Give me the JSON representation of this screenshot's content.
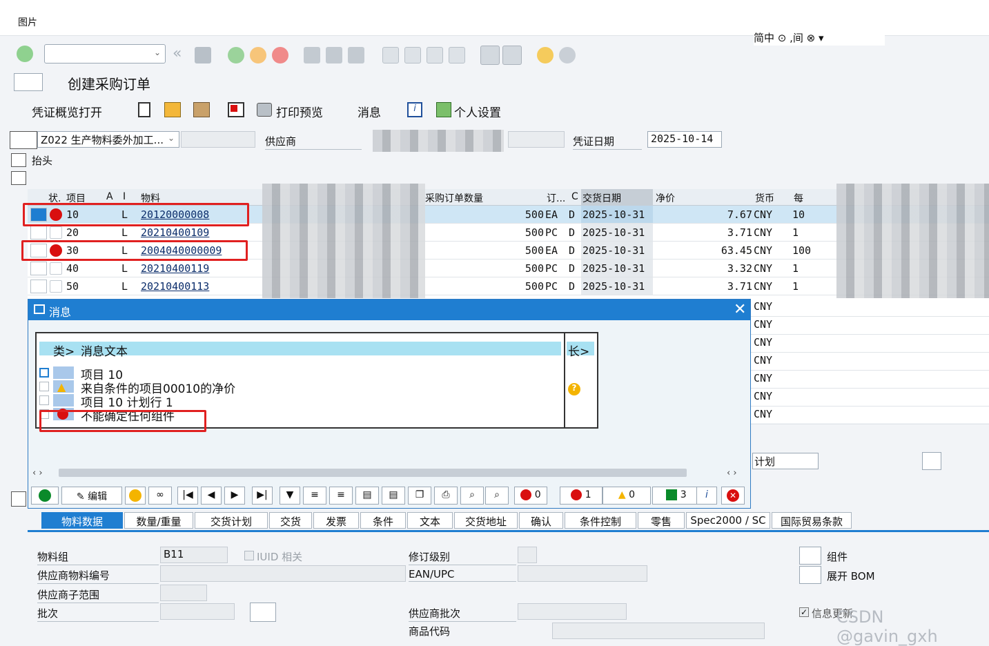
{
  "window": {
    "title": "图片"
  },
  "toolbar": {
    "command_field": "",
    "right_partial_text": "简中 ⊙ ,间 ⊗ ▾"
  },
  "screen": {
    "title": "创建采购订单"
  },
  "appbar": {
    "doc_overview": "凭证概览打开",
    "print_preview": "打印预览",
    "messages": "消息",
    "personal_settings": "个人设置"
  },
  "header": {
    "order_type": "Z022 生产物料委外加工...",
    "vendor_label": "供应商",
    "doc_date_label": "凭证日期",
    "doc_date": "2025-10-14",
    "header_label": "抬头"
  },
  "grid": {
    "headers": {
      "status": "状.",
      "item": "项目",
      "a": "A",
      "i": "I",
      "material": "物料",
      "po_qty": "采购订单数量",
      "order_unit": "订...",
      "c": "C",
      "delivery_date": "交货日期",
      "net_price": "净价",
      "currency": "货币",
      "per": "每"
    },
    "rows": [
      {
        "item": "10",
        "i": "L",
        "material": "20120000008",
        "qty": "500",
        "unit": "EA",
        "c": "D",
        "date": "2025-10-31",
        "price": "7.67",
        "currency": "CNY",
        "per": "10",
        "status": "error"
      },
      {
        "item": "20",
        "i": "L",
        "material": "20210400109",
        "qty": "500",
        "unit": "PC",
        "c": "D",
        "date": "2025-10-31",
        "price": "3.71",
        "currency": "CNY",
        "per": "1",
        "status": ""
      },
      {
        "item": "30",
        "i": "L",
        "material": "2004040000009",
        "qty": "500",
        "unit": "EA",
        "c": "D",
        "date": "2025-10-31",
        "price": "63.45",
        "currency": "CNY",
        "per": "100",
        "status": "error"
      },
      {
        "item": "40",
        "i": "L",
        "material": "20210400119",
        "qty": "500",
        "unit": "PC",
        "c": "D",
        "date": "2025-10-31",
        "price": "3.32",
        "currency": "CNY",
        "per": "1",
        "status": ""
      },
      {
        "item": "50",
        "i": "L",
        "material": "20210400113",
        "qty": "500",
        "unit": "PC",
        "c": "D",
        "date": "2025-10-31",
        "price": "3.71",
        "currency": "CNY",
        "per": "1",
        "status": ""
      }
    ],
    "empty_currency": [
      "CNY",
      "CNY",
      "CNY",
      "CNY",
      "CNY",
      "CNY",
      "CNY"
    ]
  },
  "dialog": {
    "title": "消息",
    "col_type": "类>",
    "col_text": "消息文本",
    "col_long": "长>",
    "messages": [
      {
        "text": "项目 10",
        "type": "info"
      },
      {
        "text": "来自条件的项目00010的净价",
        "type": "warning"
      },
      {
        "text": "项目 10 计划行 1",
        "type": "info"
      },
      {
        "text": "不能确定任何组件",
        "type": "error"
      }
    ],
    "buttons": {
      "edit": "编辑",
      "stop_count": "0",
      "error_count": "1",
      "warning_count": "0",
      "success_count": "3"
    },
    "behind_text": "计划"
  },
  "tabs": [
    "物料数据",
    "数量/重量",
    "交货计划",
    "交货",
    "发票",
    "条件",
    "文本",
    "交货地址",
    "确认",
    "条件控制",
    "零售",
    "Spec2000 / SC",
    "国际贸易条款"
  ],
  "material_data": {
    "material_group_label": "物料组",
    "material_group": "B11",
    "iuid_label": "IUID 相关",
    "revision_label": "修订级别",
    "vendor_mat_label": "供应商物料编号",
    "ean_label": "EAN/UPC",
    "vendor_subrange_label": "供应商子范围",
    "batch_label": "批次",
    "vendor_batch_label": "供应商批次",
    "product_code_label": "商品代码",
    "components_label": "组件",
    "explode_bom_label": "展开 BOM",
    "info_update_label": "信息更新"
  },
  "watermark": "CSDN @gavin_gxh",
  "colors": {
    "accent": "#1f7ed1",
    "error": "#d90f0f",
    "warning": "#f4b400",
    "success": "#0a8a2a",
    "annotation": "#e02020"
  }
}
